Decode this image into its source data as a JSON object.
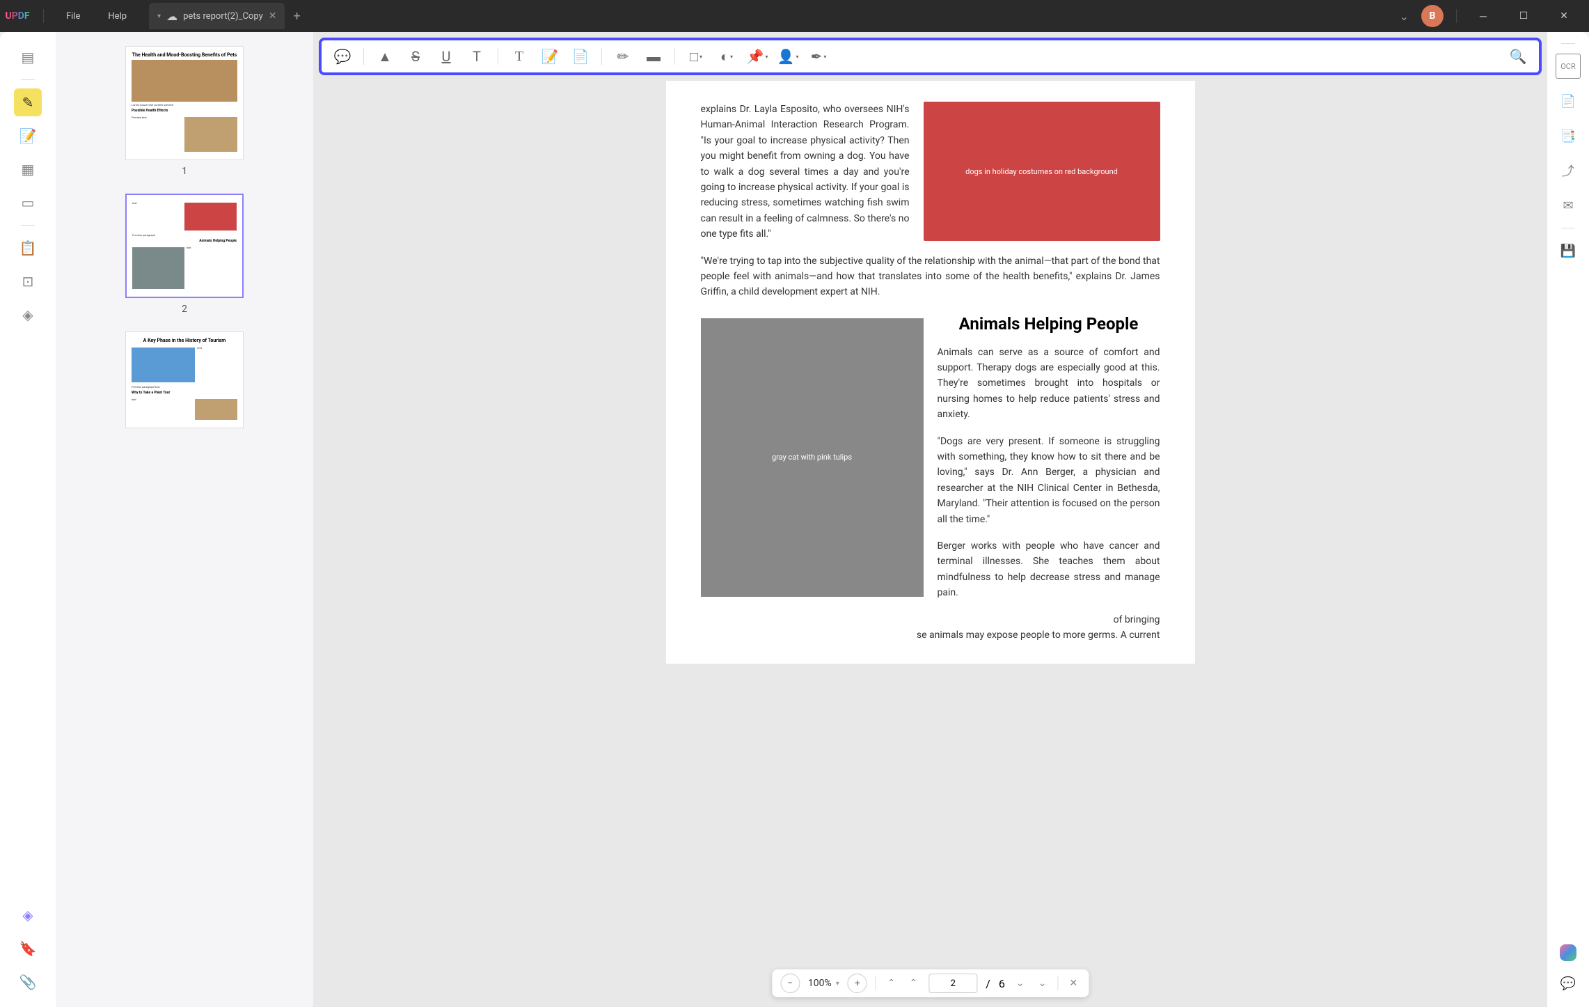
{
  "app": {
    "name": "UPDF"
  },
  "menu": {
    "file": "File",
    "help": "Help"
  },
  "tab": {
    "title": "pets report(2)_Copy",
    "icon": "☁"
  },
  "avatar": {
    "initial": "B"
  },
  "thumbs": {
    "page1": {
      "num": "1",
      "title": "The Health and Mood-Boosting Benefits of Pets",
      "subtitle": "Possible Health Effects"
    },
    "page2": {
      "num": "2",
      "title": "Animals Helping People"
    },
    "page3": {
      "num": "3",
      "title": "A Key Phase in the History of Tourism",
      "subtitle": "Why to Take a Plant Tour"
    }
  },
  "doc": {
    "para1": "explains Dr. Layla Esposito, who oversees NIH's Human-Animal Interaction Research Program. \"Is your goal to increase physical activity? Then you might benefit from owning a dog. You have to walk a dog several times a day and you're going to increase physical activity. If your goal is reducing stress, sometimes watching fish swim can result in a feeling of calmness. So there's no one type fits all.\"",
    "para2": "\"We're trying to tap into the subjective quality of the relationship with the animal—that part of the bond that people feel with animals—and how that translates into some of the health benefits,\" explains Dr. James Griffin, a child development expert at NIH.",
    "heading": "Animals Helping People",
    "para3": "Animals can serve as a source of comfort and support. Therapy dogs are especially good at this. They're sometimes brought into hospitals or nursing homes to help reduce patients' stress and anxiety.",
    "para4": "\"Dogs are very present. If someone is struggling with something, they know how to sit there and be loving,\" says Dr. Ann Berger, a physician and researcher at the NIH Clinical Center in Bethesda, Maryland. \"Their attention is focused on the person all the time.\"",
    "para5": "Berger works with people who have cancer and terminal illnesses. She teaches them about mindfulness to help decrease stress and manage pain.",
    "para6_frag1": "of bringing",
    "para6_frag2": "se animals may expose people to more germs. A current",
    "img1_alt": "dogs in holiday costumes on red background",
    "img2_alt": "gray cat with pink tulips"
  },
  "zoom": {
    "level": "100%",
    "page": "2",
    "sep": "/",
    "total": "6"
  }
}
